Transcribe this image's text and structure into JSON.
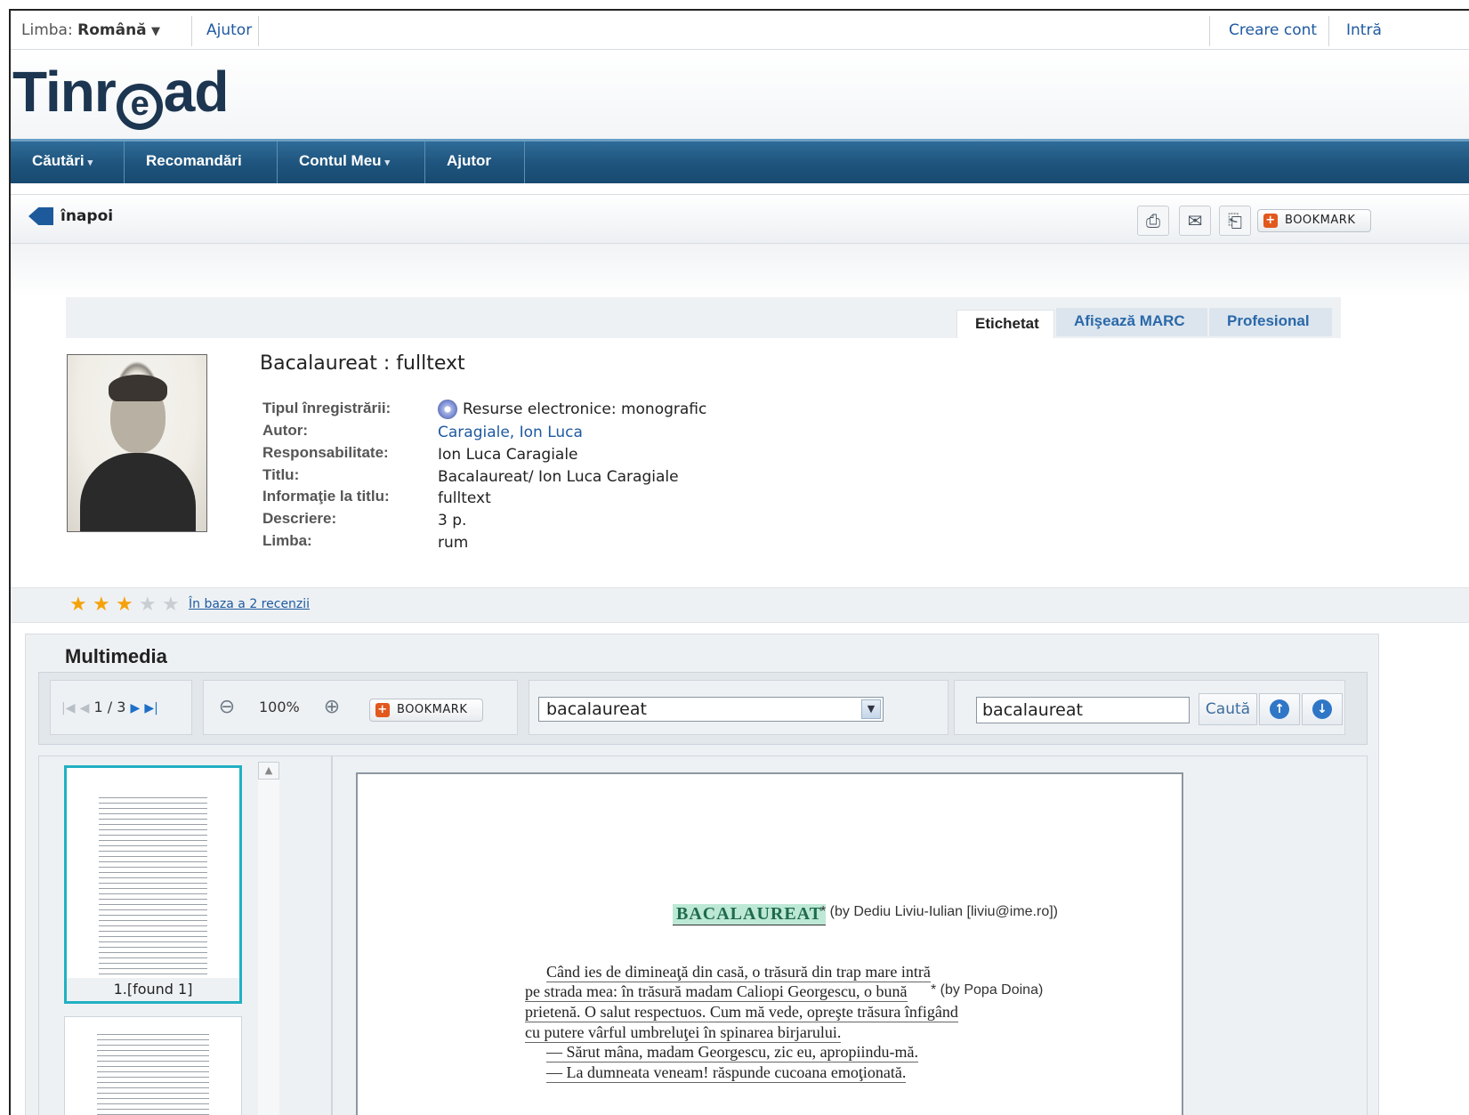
{
  "topbar": {
    "language_label": "Limba:",
    "language_value": "Română",
    "language_caret": "▼",
    "help": "Ajutor",
    "create_account": "Creare cont",
    "login": "Intră"
  },
  "logo": {
    "part1": "Tinr",
    "at": "e",
    "part2": "ad"
  },
  "nav": {
    "items": [
      {
        "label": "Căutări",
        "caret": "▾"
      },
      {
        "label": "Recomandări"
      },
      {
        "label": "Contul Meu",
        "caret": "▾"
      },
      {
        "label": "Ajutor"
      }
    ]
  },
  "backbar": {
    "back_label": "înapoi",
    "print_icon": "printer-icon",
    "email_icon": "email-icon",
    "save_icon": "save-icon",
    "bookmark_label": "BOOKMARK"
  },
  "tabs": [
    {
      "label": "Etichetat",
      "active": true
    },
    {
      "label": "Afişează MARC",
      "active": false
    },
    {
      "label": "Profesional",
      "active": false
    }
  ],
  "record": {
    "title": "Bacalaureat : fulltext",
    "fields": [
      {
        "label": "Tipul înregistrării:",
        "value": "Resurse electronice: monografic",
        "icon": "cd-icon"
      },
      {
        "label": "Autor:",
        "value": "Caragiale, Ion Luca",
        "link": true
      },
      {
        "label": "Responsabilitate:",
        "value": "Ion Luca Caragiale"
      },
      {
        "label": "Titlu:",
        "value": "Bacalaureat/ Ion Luca Caragiale"
      },
      {
        "label": "Informaţie la titlu:",
        "value": "fulltext"
      },
      {
        "label": "Descriere:",
        "value": "3 p."
      },
      {
        "label": "Limba:",
        "value": "rum"
      }
    ]
  },
  "rating": {
    "stars": 3,
    "max": 5,
    "reviews_text": "În baza a 2 recenzii",
    "star_char": "★"
  },
  "multimedia": {
    "title": "Multimedia",
    "pager": {
      "current": "1",
      "separator": "/",
      "total": "3"
    },
    "zoom": "100%",
    "bookmark_label": "BOOKMARK",
    "combo_value": "bacalaureat",
    "search_value": "bacalaureat",
    "search_button": "Caută",
    "thumbnails": [
      {
        "caption": "1.[found 1]"
      },
      {
        "caption": ""
      }
    ],
    "document": {
      "heading": "BACALAUREAT",
      "annotation1": "* (by Dediu Liviu-Iulian [liviu@ime.ro])",
      "annotation2": "* (by Popa Doina)",
      "lines": [
        "Când ies de dimineaţă din casă, o trăsură din trap mare intră",
        "pe strada mea: în trăsură madam Caliopi Georgescu, o bună",
        "prietenă. O salut respectuos. Cum mă vede, opreşte trăsura înfigând",
        "cu putere vârful umbreluţei în spinarea birjarului.",
        "— Sărut mâna, madam Georgescu, zic eu, apropiindu-mă.",
        "— La dumneata veneam! răspunde cucoana emoţionată."
      ]
    }
  }
}
